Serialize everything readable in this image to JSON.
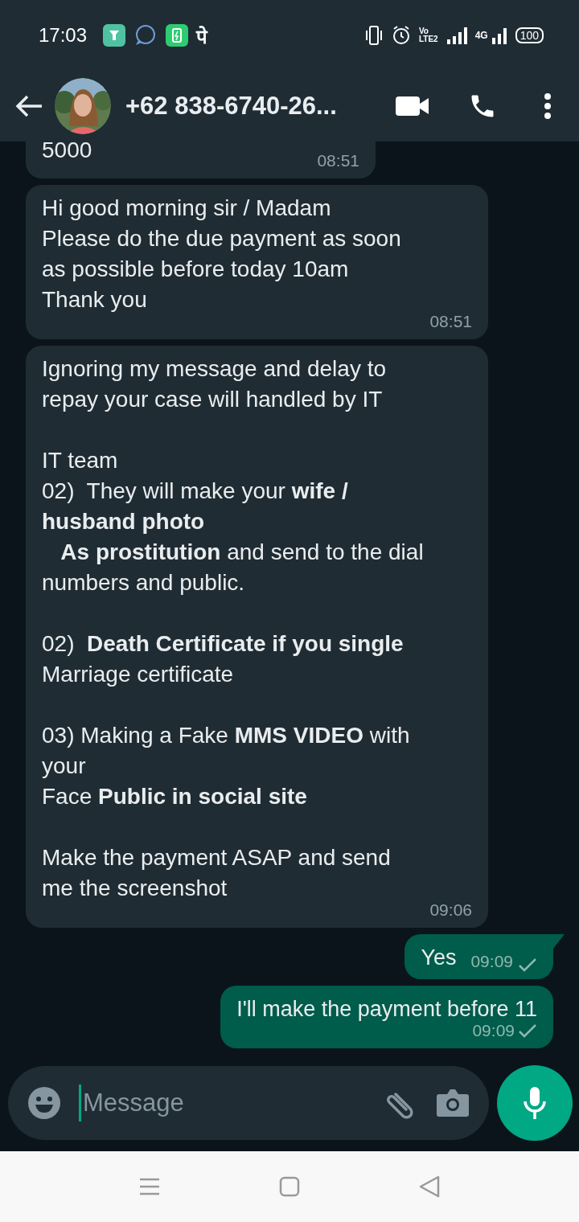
{
  "status_bar": {
    "time": "17:03",
    "app_glyph": "पे",
    "volte": "Vo",
    "volte_sub": "LTE2",
    "network": "4G",
    "battery": "100"
  },
  "header": {
    "contact": "+62 838-6740-26..."
  },
  "messages": [
    {
      "kind": "received",
      "paragraphs": [
        [
          "5000"
        ]
      ],
      "time": "08:51",
      "clipped": true
    },
    {
      "kind": "received",
      "paragraphs": [
        [
          "Hi good morning sir / Madam",
          "Please do the due payment as soon",
          "as possible before today 10am",
          "Thank you"
        ]
      ],
      "time": "08:51"
    },
    {
      "kind": "received",
      "paragraphs": [
        [
          "Ignoring my message and delay to",
          "repay your case will handled by IT"
        ],
        [
          "IT team",
          "02)  They will make your **wife /**",
          "**husband photo**",
          "   **As prostitution** and send to the dial",
          "numbers and public."
        ],
        [
          "02)  **Death Certificate if you single**",
          "Marriage certificate"
        ],
        [
          "03) Making a Fake **MMS VIDEO** with",
          "your",
          "Face **Public in social site**"
        ],
        [
          "Make the payment ASAP and send",
          "me the screenshot"
        ]
      ],
      "time": "09:06"
    },
    {
      "kind": "sent",
      "paragraphs": [
        [
          "Yes"
        ]
      ],
      "time": "09:09",
      "tail": true,
      "inline_time": true
    },
    {
      "kind": "sent",
      "paragraphs": [
        [
          "I'll make the payment before 11"
        ]
      ],
      "time": "09:09"
    }
  ],
  "composer": {
    "placeholder": "Message"
  }
}
